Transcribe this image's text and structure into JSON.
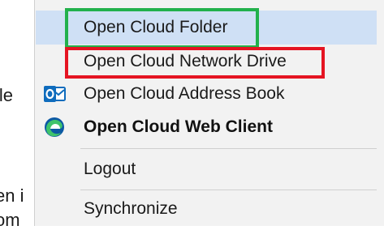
{
  "background": {
    "fragments": [
      "ile",
      "en i",
      "om"
    ]
  },
  "menu": {
    "items": [
      {
        "label": "Open Cloud Folder",
        "icon": "none"
      },
      {
        "label": "Open Cloud Network Drive",
        "icon": "none"
      },
      {
        "label": "Open Cloud Address Book",
        "icon": "outlook-icon"
      },
      {
        "label": "Open Cloud Web Client",
        "icon": "edge-icon"
      },
      {
        "label": "Logout",
        "icon": "none"
      },
      {
        "label": "Synchronize",
        "icon": "none"
      }
    ]
  },
  "colors": {
    "highlight": "#cfe0f5",
    "menu_bg": "#f2f2f2",
    "annotation_green": "#22b14c",
    "annotation_red": "#e51422",
    "outlook_blue": "#0f6cbd",
    "edge_blue": "#0c59a4",
    "edge_green": "#3fc36b"
  }
}
